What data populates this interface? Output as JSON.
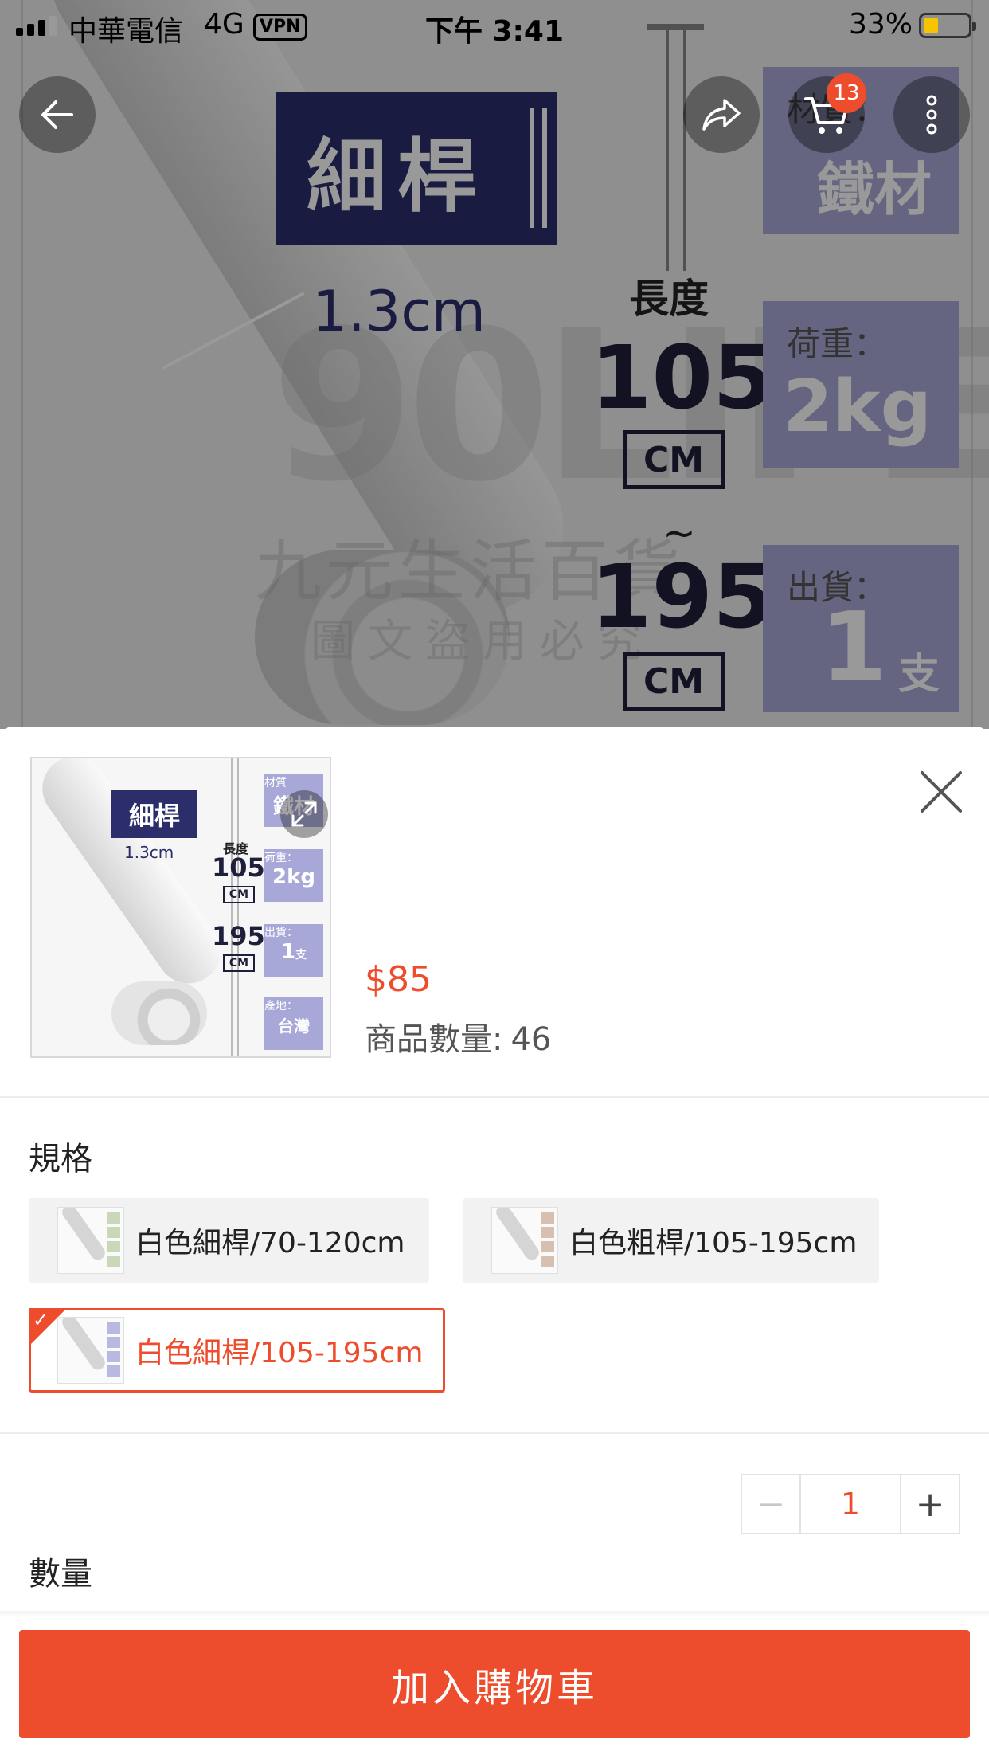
{
  "status_bar": {
    "carrier": "中華電信",
    "network": "4G",
    "vpn": "VPN",
    "time": "下午 3:41",
    "battery_percent": "33%",
    "battery_level": 0.33
  },
  "hero_image": {
    "badge": "細桿",
    "diameter": "1.3cm",
    "length_title": "長度",
    "min_length": "105",
    "max_length": "195",
    "unit": "CM",
    "tilde": "~",
    "material_label": "材質：",
    "material_value": "鐵材",
    "load_label": "荷重：",
    "load_value": "2kg",
    "ship_label": "出貨：",
    "ship_value": "1",
    "ship_unit": "支",
    "watermark_brand": "90LIFE",
    "watermark_line1": "九元生活百貨",
    "watermark_line2": "圖文盜用必究"
  },
  "top_nav": {
    "back_icon": "arrow-left-icon",
    "share_icon": "share-icon",
    "cart_icon": "cart-icon",
    "cart_count": "13",
    "more_icon": "more-vertical-icon"
  },
  "product": {
    "price": "$85",
    "stock_label": "商品數量:",
    "stock_value": "46",
    "thumb": {
      "badge": "細桿",
      "diameter": "1.3cm",
      "length_title": "長度",
      "min_length": "105",
      "max_length": "195",
      "unit": "CM",
      "material_label": "材質",
      "material_value": "鐵材",
      "load_label": "荷重：",
      "load_value": "2kg",
      "ship_label": "出貨：",
      "ship_value": "1",
      "ship_unit": "支",
      "origin_label": "產地：",
      "origin_value": "台灣"
    }
  },
  "variants": {
    "title": "規格",
    "options": [
      {
        "label": "白色細桿/70-120cm",
        "selected": false
      },
      {
        "label": "白色粗桿/105-195cm",
        "selected": false
      },
      {
        "label": "白色細桿/105-195cm",
        "selected": true
      }
    ]
  },
  "quantity": {
    "label": "數量",
    "minus": "−",
    "value": "1",
    "plus": "+"
  },
  "footer": {
    "add_to_cart": "加入購物車"
  },
  "colors": {
    "accent": "#ee4d2d",
    "badge_navy": "#2b2e6b",
    "spec_purple": "#a8a8d8"
  }
}
